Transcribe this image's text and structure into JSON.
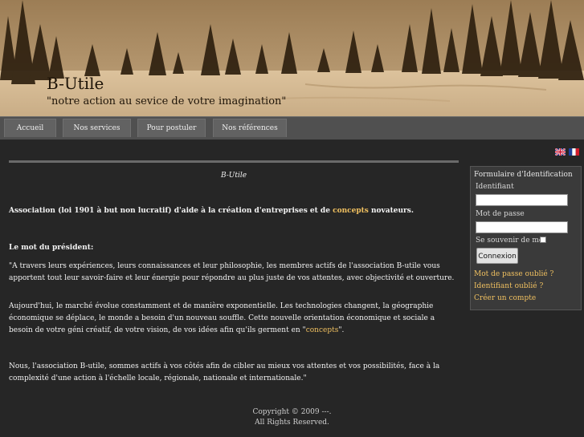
{
  "site": {
    "title": "B-Utile",
    "tagline": "\"notre action au sevice de votre imagination\""
  },
  "nav": {
    "items": [
      "Accueil",
      "Nos services",
      "Pour postuler",
      "Nos références"
    ]
  },
  "language_flags": {
    "english": "english-flag-icon",
    "french": "french-flag-icon"
  },
  "main": {
    "heading": "B-Utile",
    "association_pre": "Association (loi 1901 à but non lucratif) d'aide à la création d'entreprises et de ",
    "association_link": "concepts",
    "association_post": " novateurs.",
    "president_heading": "Le mot du président:",
    "paragraph1": "\"A travers leurs expériences, leurs connaissances et leur philosophie, les membres actifs de l'association B-utile vous apportent tout leur savoir-faire et leur énergie pour répondre au plus juste de vos attentes, avec objectivité et ouverture.",
    "paragraph2_pre": "Aujourd'hui, le marché évolue constamment et de manière exponentielle. Les technologies changent, la géographie économique se déplace, le monde a besoin d'un nouveau souffle. Cette nouvelle orientation économique et sociale a besoin de votre géni créatif, de votre vision, de vos idées afin qu'ils germent en \"",
    "paragraph2_link": "concepts",
    "paragraph2_post": "\".",
    "paragraph3": "Nous, l'association B-utile, sommes actifs à vos côtés afin de cibler au mieux vos attentes et vos possibilités, face à la complexité d'une action à l'échelle locale, régionale, nationale et internationale.\""
  },
  "login": {
    "title": "Formulaire d'Identification",
    "username_label": "Identifiant",
    "password_label": "Mot de passe",
    "remember_label": "Se souvenir de moi",
    "submit_label": "Connexion",
    "forgot_password": "Mot de passe oublié ?",
    "forgot_username": "Identifiant oublié ?",
    "create_account": "Créer un compte"
  },
  "footer": {
    "copyright": "Copyright © 2009 ---.",
    "rights": "All Rights Reserved."
  },
  "colors": {
    "accent": "#f0c060",
    "background": "#262626",
    "header_sepia": "#b99c74"
  }
}
